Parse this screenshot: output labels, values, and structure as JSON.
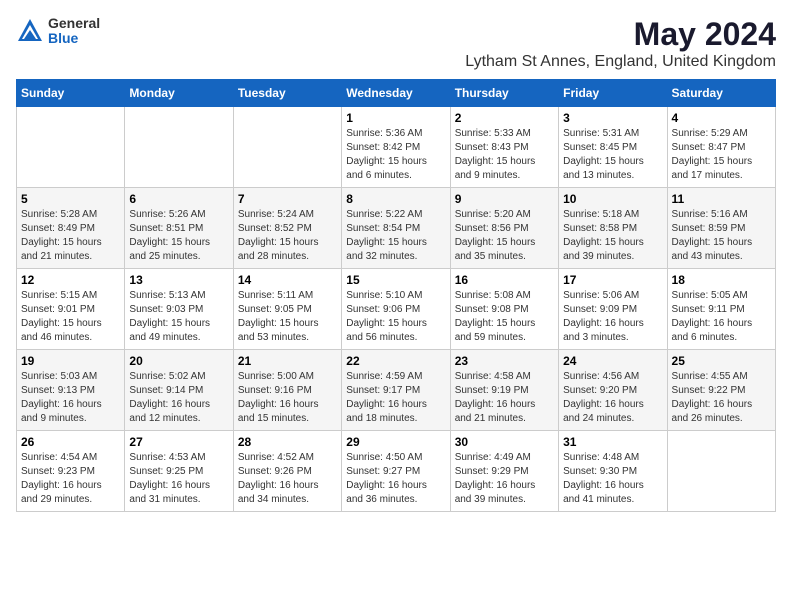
{
  "logo": {
    "general": "General",
    "blue": "Blue"
  },
  "title": {
    "month_year": "May 2024",
    "location": "Lytham St Annes, England, United Kingdom"
  },
  "headers": [
    "Sunday",
    "Monday",
    "Tuesday",
    "Wednesday",
    "Thursday",
    "Friday",
    "Saturday"
  ],
  "weeks": [
    [
      {
        "day": "",
        "info": ""
      },
      {
        "day": "",
        "info": ""
      },
      {
        "day": "",
        "info": ""
      },
      {
        "day": "1",
        "info": "Sunrise: 5:36 AM\nSunset: 8:42 PM\nDaylight: 15 hours\nand 6 minutes."
      },
      {
        "day": "2",
        "info": "Sunrise: 5:33 AM\nSunset: 8:43 PM\nDaylight: 15 hours\nand 9 minutes."
      },
      {
        "day": "3",
        "info": "Sunrise: 5:31 AM\nSunset: 8:45 PM\nDaylight: 15 hours\nand 13 minutes."
      },
      {
        "day": "4",
        "info": "Sunrise: 5:29 AM\nSunset: 8:47 PM\nDaylight: 15 hours\nand 17 minutes."
      }
    ],
    [
      {
        "day": "5",
        "info": "Sunrise: 5:28 AM\nSunset: 8:49 PM\nDaylight: 15 hours\nand 21 minutes."
      },
      {
        "day": "6",
        "info": "Sunrise: 5:26 AM\nSunset: 8:51 PM\nDaylight: 15 hours\nand 25 minutes."
      },
      {
        "day": "7",
        "info": "Sunrise: 5:24 AM\nSunset: 8:52 PM\nDaylight: 15 hours\nand 28 minutes."
      },
      {
        "day": "8",
        "info": "Sunrise: 5:22 AM\nSunset: 8:54 PM\nDaylight: 15 hours\nand 32 minutes."
      },
      {
        "day": "9",
        "info": "Sunrise: 5:20 AM\nSunset: 8:56 PM\nDaylight: 15 hours\nand 35 minutes."
      },
      {
        "day": "10",
        "info": "Sunrise: 5:18 AM\nSunset: 8:58 PM\nDaylight: 15 hours\nand 39 minutes."
      },
      {
        "day": "11",
        "info": "Sunrise: 5:16 AM\nSunset: 8:59 PM\nDaylight: 15 hours\nand 43 minutes."
      }
    ],
    [
      {
        "day": "12",
        "info": "Sunrise: 5:15 AM\nSunset: 9:01 PM\nDaylight: 15 hours\nand 46 minutes."
      },
      {
        "day": "13",
        "info": "Sunrise: 5:13 AM\nSunset: 9:03 PM\nDaylight: 15 hours\nand 49 minutes."
      },
      {
        "day": "14",
        "info": "Sunrise: 5:11 AM\nSunset: 9:05 PM\nDaylight: 15 hours\nand 53 minutes."
      },
      {
        "day": "15",
        "info": "Sunrise: 5:10 AM\nSunset: 9:06 PM\nDaylight: 15 hours\nand 56 minutes."
      },
      {
        "day": "16",
        "info": "Sunrise: 5:08 AM\nSunset: 9:08 PM\nDaylight: 15 hours\nand 59 minutes."
      },
      {
        "day": "17",
        "info": "Sunrise: 5:06 AM\nSunset: 9:09 PM\nDaylight: 16 hours\nand 3 minutes."
      },
      {
        "day": "18",
        "info": "Sunrise: 5:05 AM\nSunset: 9:11 PM\nDaylight: 16 hours\nand 6 minutes."
      }
    ],
    [
      {
        "day": "19",
        "info": "Sunrise: 5:03 AM\nSunset: 9:13 PM\nDaylight: 16 hours\nand 9 minutes."
      },
      {
        "day": "20",
        "info": "Sunrise: 5:02 AM\nSunset: 9:14 PM\nDaylight: 16 hours\nand 12 minutes."
      },
      {
        "day": "21",
        "info": "Sunrise: 5:00 AM\nSunset: 9:16 PM\nDaylight: 16 hours\nand 15 minutes."
      },
      {
        "day": "22",
        "info": "Sunrise: 4:59 AM\nSunset: 9:17 PM\nDaylight: 16 hours\nand 18 minutes."
      },
      {
        "day": "23",
        "info": "Sunrise: 4:58 AM\nSunset: 9:19 PM\nDaylight: 16 hours\nand 21 minutes."
      },
      {
        "day": "24",
        "info": "Sunrise: 4:56 AM\nSunset: 9:20 PM\nDaylight: 16 hours\nand 24 minutes."
      },
      {
        "day": "25",
        "info": "Sunrise: 4:55 AM\nSunset: 9:22 PM\nDaylight: 16 hours\nand 26 minutes."
      }
    ],
    [
      {
        "day": "26",
        "info": "Sunrise: 4:54 AM\nSunset: 9:23 PM\nDaylight: 16 hours\nand 29 minutes."
      },
      {
        "day": "27",
        "info": "Sunrise: 4:53 AM\nSunset: 9:25 PM\nDaylight: 16 hours\nand 31 minutes."
      },
      {
        "day": "28",
        "info": "Sunrise: 4:52 AM\nSunset: 9:26 PM\nDaylight: 16 hours\nand 34 minutes."
      },
      {
        "day": "29",
        "info": "Sunrise: 4:50 AM\nSunset: 9:27 PM\nDaylight: 16 hours\nand 36 minutes."
      },
      {
        "day": "30",
        "info": "Sunrise: 4:49 AM\nSunset: 9:29 PM\nDaylight: 16 hours\nand 39 minutes."
      },
      {
        "day": "31",
        "info": "Sunrise: 4:48 AM\nSunset: 9:30 PM\nDaylight: 16 hours\nand 41 minutes."
      },
      {
        "day": "",
        "info": ""
      }
    ]
  ]
}
